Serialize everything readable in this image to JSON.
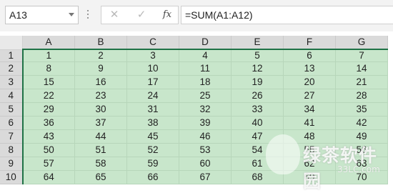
{
  "formula_bar": {
    "name_box": "A13",
    "cancel_glyph": "✕",
    "enter_glyph": "✓",
    "fx_label": "fx",
    "formula": "=SUM(A1:A12)"
  },
  "columns": [
    "A",
    "B",
    "C",
    "D",
    "E",
    "F",
    "G"
  ],
  "rows": [
    {
      "label": "1",
      "cells": [
        "1",
        "2",
        "3",
        "4",
        "5",
        "6",
        "7"
      ]
    },
    {
      "label": "2",
      "cells": [
        "8",
        "9",
        "10",
        "11",
        "12",
        "13",
        "14"
      ]
    },
    {
      "label": "3",
      "cells": [
        "15",
        "16",
        "17",
        "18",
        "19",
        "20",
        "21"
      ]
    },
    {
      "label": "4",
      "cells": [
        "22",
        "23",
        "24",
        "25",
        "26",
        "27",
        "28"
      ]
    },
    {
      "label": "5",
      "cells": [
        "29",
        "30",
        "31",
        "32",
        "33",
        "34",
        "35"
      ]
    },
    {
      "label": "6",
      "cells": [
        "36",
        "37",
        "38",
        "39",
        "40",
        "41",
        "42"
      ]
    },
    {
      "label": "7",
      "cells": [
        "43",
        "44",
        "45",
        "46",
        "47",
        "48",
        "49"
      ]
    },
    {
      "label": "8",
      "cells": [
        "50",
        "51",
        "52",
        "53",
        "54",
        "55",
        "56"
      ]
    },
    {
      "label": "9",
      "cells": [
        "57",
        "58",
        "59",
        "60",
        "61",
        "62",
        "63"
      ]
    },
    {
      "label": "10",
      "cells": [
        "64",
        "65",
        "66",
        "67",
        "68",
        "69",
        "70"
      ]
    }
  ],
  "watermark": {
    "text": "绿茶软件园",
    "url": "33LC.com"
  },
  "colors": {
    "selection_fill": "#c8e6cb",
    "header_active_border": "#1f7246",
    "header_bg": "#dadada"
  }
}
